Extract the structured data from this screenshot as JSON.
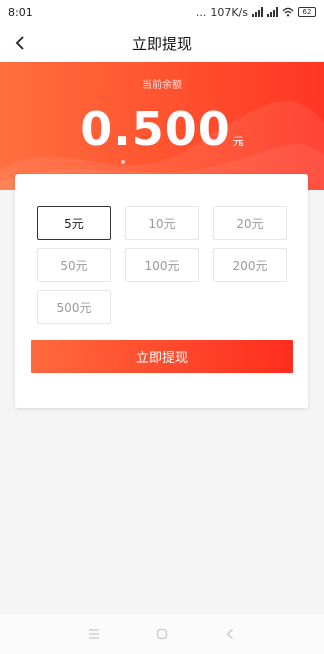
{
  "status_bar": {
    "time": "8:01",
    "dots": "...",
    "speed": "107K/s",
    "battery": "62"
  },
  "navbar": {
    "title": "立即提现",
    "back_icon": "chevron-left-icon"
  },
  "balance": {
    "label": "当前余额",
    "amount": "0.500",
    "unit": "元"
  },
  "amount_options": [
    {
      "label": "5元",
      "selected": true
    },
    {
      "label": "10元",
      "selected": false
    },
    {
      "label": "20元",
      "selected": false
    },
    {
      "label": "50元",
      "selected": false
    },
    {
      "label": "100元",
      "selected": false
    },
    {
      "label": "200元",
      "selected": false
    },
    {
      "label": "500元",
      "selected": false
    }
  ],
  "withdraw_button": {
    "label": "立即提现"
  },
  "system_nav": {
    "menu_icon": "menu-icon",
    "home_icon": "home-circle-icon",
    "back_icon": "back-triangle-icon"
  },
  "colors": {
    "accent_start": "#ff6f3f",
    "accent_end": "#ff3524",
    "background": "#f5f5f5"
  }
}
